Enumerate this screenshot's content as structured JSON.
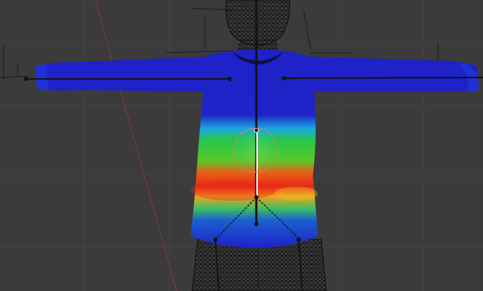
{
  "viewport": {
    "mode": "weight-paint",
    "colors": {
      "background": "#3b3b3b",
      "grid": "#454545",
      "axis_line": "#8a3a3a",
      "weight_zero": "#1e22c8",
      "weight_low": "#1aa8e0",
      "weight_mid": "#28c84a",
      "weight_high": "#f0c820",
      "weight_max": "#e82818",
      "wire": "#0a0a0a",
      "bone": "#111111",
      "bone_highlight": "#ffffff",
      "bone_circle": "#b48c6e"
    }
  },
  "scene_objects": {
    "armature": "armature",
    "shirt_mesh": "shirt-mesh",
    "body_wireframe": "body-wireframe"
  }
}
